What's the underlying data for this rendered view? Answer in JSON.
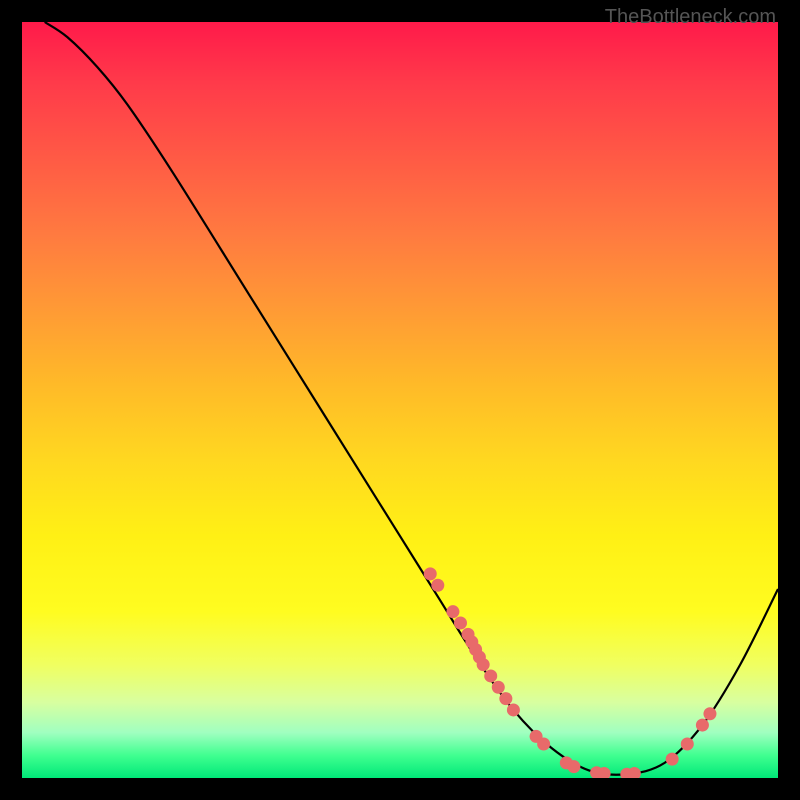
{
  "watermark": "TheBottleneck.com",
  "chart_data": {
    "type": "line",
    "title": "",
    "xlabel": "",
    "ylabel": "",
    "xlim": [
      0,
      100
    ],
    "ylim": [
      0,
      100
    ],
    "curve": [
      {
        "x": 3,
        "y": 100
      },
      {
        "x": 6,
        "y": 98
      },
      {
        "x": 10,
        "y": 94
      },
      {
        "x": 14,
        "y": 89
      },
      {
        "x": 20,
        "y": 80
      },
      {
        "x": 30,
        "y": 64
      },
      {
        "x": 40,
        "y": 48
      },
      {
        "x": 50,
        "y": 32
      },
      {
        "x": 55,
        "y": 24
      },
      {
        "x": 60,
        "y": 16
      },
      {
        "x": 65,
        "y": 9
      },
      {
        "x": 70,
        "y": 4
      },
      {
        "x": 75,
        "y": 1
      },
      {
        "x": 80,
        "y": 0.5
      },
      {
        "x": 85,
        "y": 2
      },
      {
        "x": 90,
        "y": 7
      },
      {
        "x": 95,
        "y": 15
      },
      {
        "x": 100,
        "y": 25
      }
    ],
    "dots": [
      {
        "x": 54,
        "y": 27
      },
      {
        "x": 55,
        "y": 25.5
      },
      {
        "x": 57,
        "y": 22
      },
      {
        "x": 58,
        "y": 20.5
      },
      {
        "x": 59,
        "y": 19
      },
      {
        "x": 59.5,
        "y": 18
      },
      {
        "x": 60,
        "y": 17
      },
      {
        "x": 60.5,
        "y": 16
      },
      {
        "x": 61,
        "y": 15
      },
      {
        "x": 62,
        "y": 13.5
      },
      {
        "x": 63,
        "y": 12
      },
      {
        "x": 64,
        "y": 10.5
      },
      {
        "x": 65,
        "y": 9
      },
      {
        "x": 68,
        "y": 5.5
      },
      {
        "x": 69,
        "y": 4.5
      },
      {
        "x": 72,
        "y": 2
      },
      {
        "x": 73,
        "y": 1.5
      },
      {
        "x": 76,
        "y": 0.7
      },
      {
        "x": 77,
        "y": 0.6
      },
      {
        "x": 80,
        "y": 0.5
      },
      {
        "x": 81,
        "y": 0.6
      },
      {
        "x": 86,
        "y": 2.5
      },
      {
        "x": 88,
        "y": 4.5
      },
      {
        "x": 90,
        "y": 7
      },
      {
        "x": 91,
        "y": 8.5
      }
    ],
    "dot_color": "#e86a6a",
    "curve_color": "#000000"
  }
}
